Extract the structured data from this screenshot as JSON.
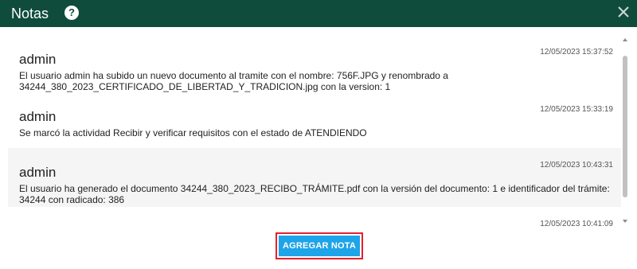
{
  "header": {
    "title": "Notas",
    "help_icon": "help-circle-icon",
    "help_glyph": "?",
    "close_icon": "close-icon"
  },
  "notes": [
    {
      "author": "admin",
      "date": "12/05/2023 15:37:52",
      "text": "El usuario admin ha subido un nuevo documento al tramite con el nombre: 756F.JPG y renombrado a 34244_380_2023_CERTIFICADO_DE_LIBERTAD_Y_TRADICION.jpg con la version: 1"
    },
    {
      "author": "admin",
      "date": "12/05/2023 15:33:19",
      "text": "Se marcó la actividad Recibir y verificar requisitos con el estado de ATENDIENDO"
    },
    {
      "author": "admin",
      "date": "12/05/2023 10:43:31",
      "text": "El usuario ha generado el documento 34244_380_2023_RECIBO_TRÁMITE.pdf con la versión del documento: 1 e identificador del trámite: 34244 con radicado: 386"
    },
    {
      "author": "admin",
      "date": "12/05/2023 10:41:09",
      "text": ""
    }
  ],
  "footer": {
    "add_button_label": "AGREGAR NOTA"
  },
  "colors": {
    "header_bg": "#0f4c3c",
    "button_bg": "#1ea4e8",
    "highlight_border": "#e5202a"
  }
}
